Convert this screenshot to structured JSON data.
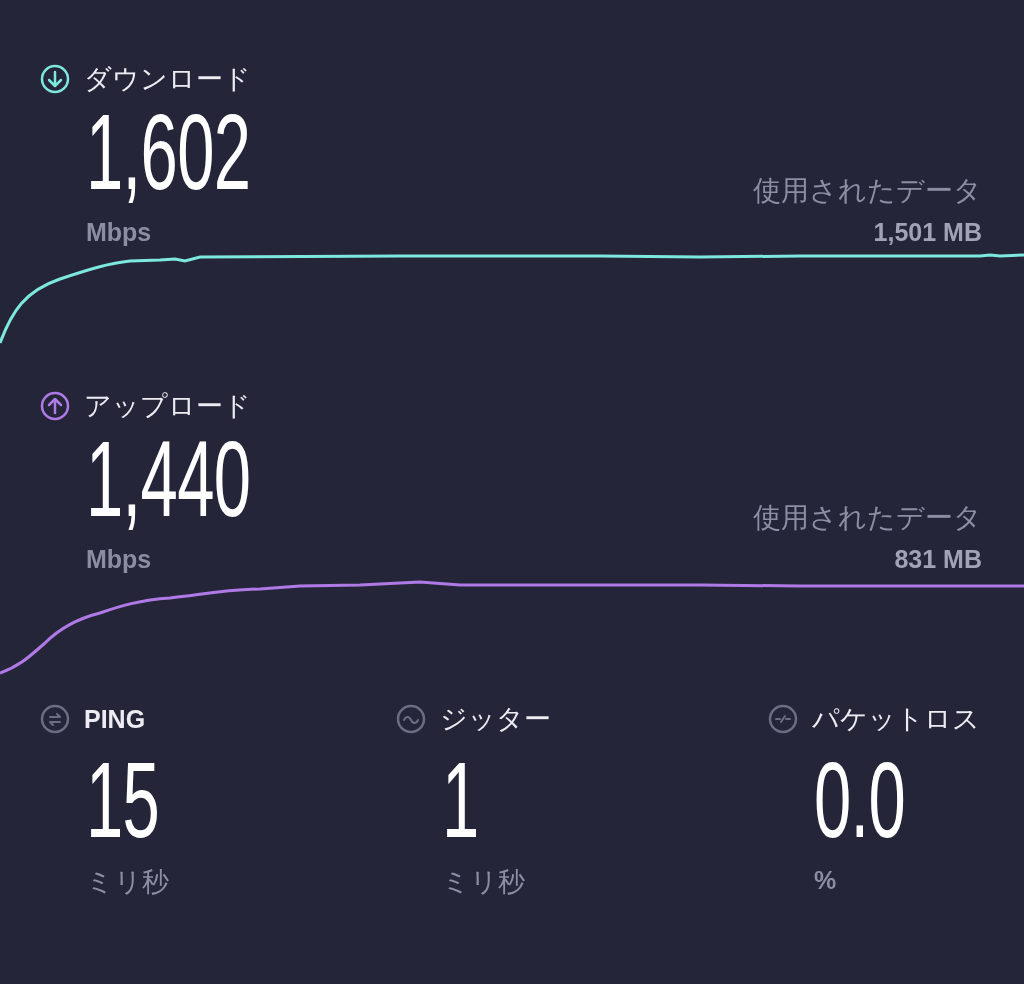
{
  "tests": [
    {
      "kind": "download",
      "color": "#7de8de",
      "label": "ダウンロード",
      "value": "1,602",
      "unit": "Mbps",
      "data_label": "使用されたデータ",
      "data_value": "1,501 MB"
    },
    {
      "kind": "upload",
      "color": "#b07ae6",
      "label": "アップロード",
      "value": "1,440",
      "unit": "Mbps",
      "data_label": "使用されたデータ",
      "data_value": "831 MB"
    }
  ],
  "metrics": [
    {
      "kind": "ping",
      "label": "PING",
      "value": "15",
      "unit": "ミリ秒"
    },
    {
      "kind": "jitter",
      "label": "ジッター",
      "value": "1",
      "unit": "ミリ秒"
    },
    {
      "kind": "loss",
      "label": "パケットロス",
      "value": "0.0",
      "unit": "%"
    }
  ]
}
